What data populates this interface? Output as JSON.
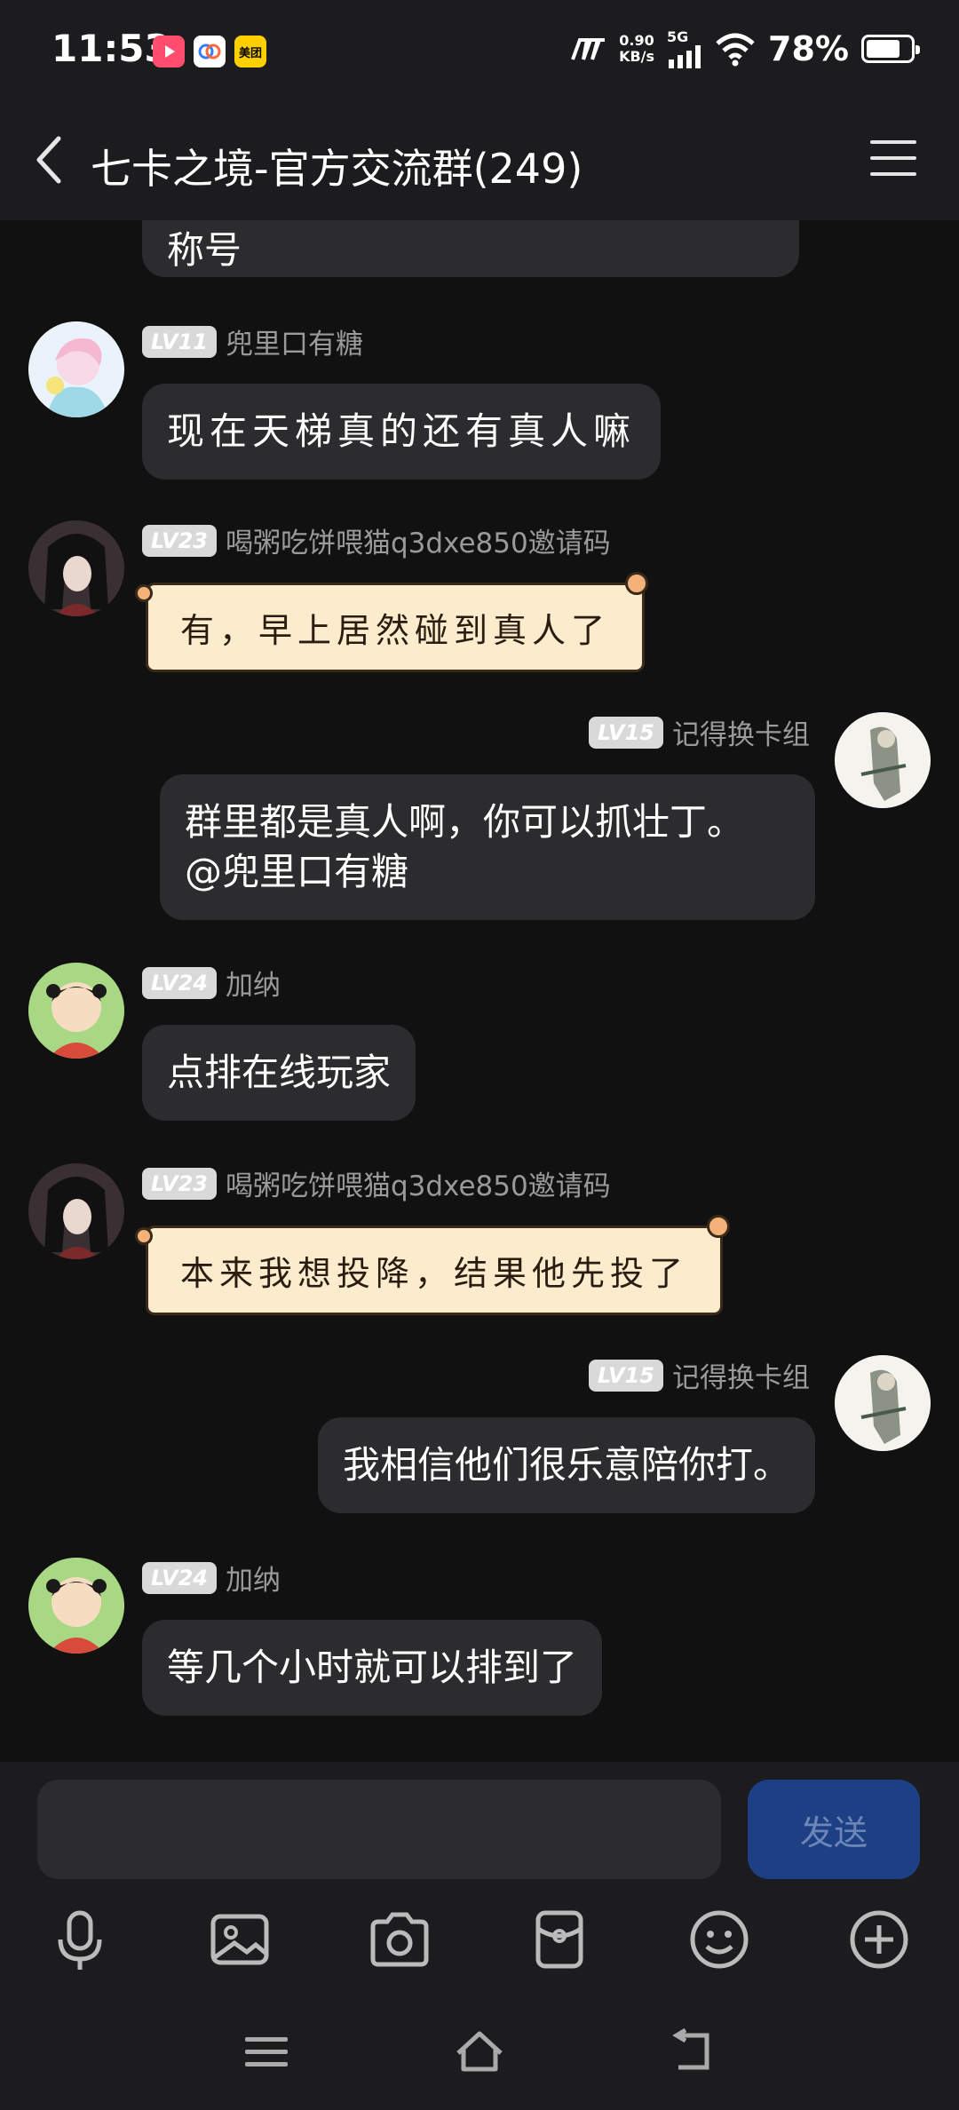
{
  "status_bar": {
    "time": "11:53",
    "app_icons": [
      {
        "name": "video-app-icon",
        "color": "#ff4d6d",
        "label": ""
      },
      {
        "name": "baidu-netdisk-icon",
        "color": "#ffffff",
        "label": ""
      },
      {
        "name": "meituan-icon",
        "color": "#ffd000",
        "label": "美团"
      }
    ],
    "speed_value": "0.90",
    "speed_unit": "KB/s",
    "network": "5G",
    "battery": "78%",
    "battery_level": 0.78
  },
  "header": {
    "title": "七卡之境-官方交流群(249)"
  },
  "messages": [
    {
      "id": "m0",
      "side": "left",
      "partial": true,
      "text": "称号"
    },
    {
      "id": "m1",
      "side": "left",
      "level": "LV11",
      "sender": "兜里口有糖",
      "text": "现在天梯真的还有真人嘛",
      "style": "handwriting"
    },
    {
      "id": "m2",
      "side": "left",
      "level": "LV23",
      "sender": "喝粥吃饼喂猫q3dxe850邀请码",
      "text": "有，早上居然碰到真人了",
      "style": "paper"
    },
    {
      "id": "m3",
      "side": "right",
      "level": "LV15",
      "sender": "记得换卡组",
      "text_line1": "群里都是真人啊，你可以抓壮丁。",
      "text_line2": "@兜里口有糖"
    },
    {
      "id": "m4",
      "side": "left",
      "level": "LV24",
      "sender": "加纳",
      "text": "点排在线玩家"
    },
    {
      "id": "m5",
      "side": "left",
      "level": "LV23",
      "sender": "喝粥吃饼喂猫q3dxe850邀请码",
      "text": "本来我想投降，结果他先投了",
      "style": "paper"
    },
    {
      "id": "m6",
      "side": "right",
      "level": "LV15",
      "sender": "记得换卡组",
      "text": "我相信他们很乐意陪你打。"
    },
    {
      "id": "m7",
      "side": "left",
      "level": "LV24",
      "sender": "加纳",
      "text": "等几个小时就可以排到了"
    }
  ],
  "input": {
    "placeholder": "",
    "send_label": "发送"
  },
  "toolbar": [
    "microphone-icon",
    "image-icon",
    "camera-icon",
    "red-packet-icon",
    "emoji-icon",
    "plus-icon"
  ],
  "nav": [
    "menu-nav-icon",
    "home-nav-icon",
    "back-nav-icon"
  ],
  "colors": {
    "background": "#111111",
    "bubble": "#2c2c2e",
    "send_button": "#1d3f83",
    "paper_bubble": "#fbeccd"
  }
}
